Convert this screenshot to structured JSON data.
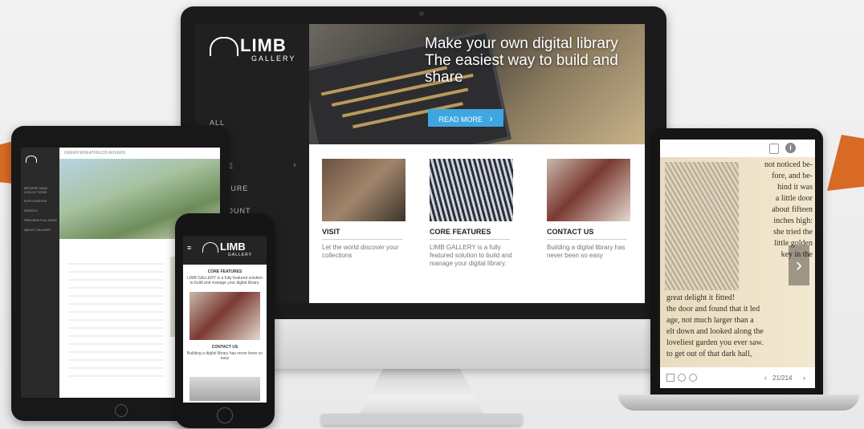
{
  "desktop": {
    "logo_word": "LIMB",
    "logo_sub": "GALLERY",
    "sidebar_items": [
      "ALL",
      "CORE",
      "FEATURE",
      "ACCOUNT"
    ],
    "hero_title": "Make your own digital library The easiest way to build and share",
    "read_more_label": "READ MORE",
    "read_more_arrow": "›",
    "features": [
      {
        "title": "VISIT",
        "text": "Let the world discover your collections"
      },
      {
        "title": "CORE FEATURES",
        "text": "LIMB GALLERY is a fully featured solution to build and manage your digital library."
      },
      {
        "title": "CONTACT US",
        "text": "Building a digital library has never been so easy"
      }
    ]
  },
  "laptop": {
    "book_right_lines": [
      "not noticed be-",
      "fore, and be-",
      "hind it was",
      "a little door",
      "about fifteen",
      "inches high:",
      "she tried the",
      "little golden",
      "key in the"
    ],
    "book_full_lines": [
      "great delight it fitted!",
      "the door and found that it led",
      "age, not much larger than a",
      "elt down and looked along the",
      "loveliest garden you ever saw.",
      "to get out of that dark hall,"
    ],
    "next_arrow": "›",
    "page_indicator": "21/214",
    "toolbar_info": "i"
  },
  "tablet": {
    "title": "GREEN WHEATFIELDS AUVERS",
    "side_items": [
      "BROWSE MAIN COLLECTIONS",
      "EXPLORATION",
      "SEARCH",
      "PREVIEW FULL PAGE",
      "ABOUT GALLERY"
    ]
  },
  "phone": {
    "logo_word": "LIMB",
    "logo_sub": "GALLERY",
    "menu_icon": "≡",
    "section1_title": "CORE FEATURES",
    "section1_text": "LIMB GALLERY is a fully featured solution to build and manage your digital library.",
    "section2_title": "CONTACT US",
    "section2_text": "Building a digital library has never been so easy"
  }
}
